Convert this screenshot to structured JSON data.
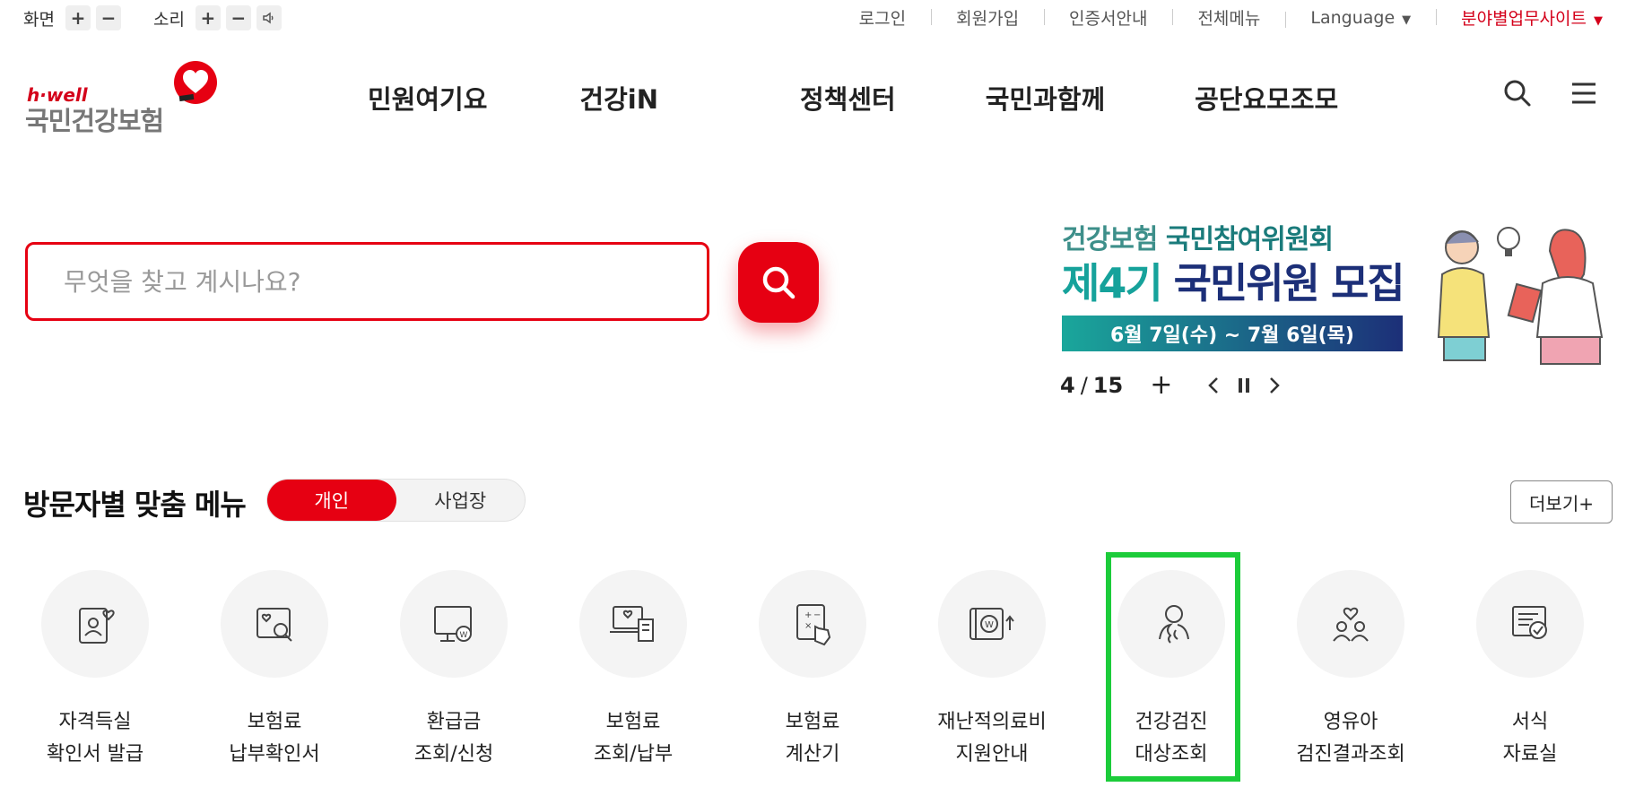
{
  "util": {
    "screen_label": "화면",
    "sound_label": "소리",
    "plus": "+",
    "minus": "−",
    "links": {
      "login": "로그인",
      "signup": "회원가입",
      "cert": "인증서안내",
      "sitemap": "전체메뉴",
      "language": "Language",
      "field_site": "분야별업무사이트"
    }
  },
  "logo": {
    "brand": "h·well",
    "name": "국민건강보험"
  },
  "gnb": [
    "민원여기요",
    "건강iN",
    "정책센터",
    "국민과함께",
    "공단요모조모"
  ],
  "search": {
    "placeholder": "무엇을 찾고 계시나요?"
  },
  "banner": {
    "line1_prefix": "건강보험 ",
    "line1_highlight": "국민참여위원회",
    "line2_prefix": "제4기 ",
    "line2_highlight": "국민위원 모집",
    "date_text": "6월 7일(수) ~ 7월 6일(목)",
    "current": "4",
    "separator": "/",
    "total": "15",
    "plus": "+"
  },
  "visitor_menu": {
    "title": "방문자별 맞춤 메뉴",
    "tab_personal": "개인",
    "tab_business": "사업장",
    "more": "더보기+",
    "items": [
      {
        "label": "자격득실\n확인서 발급",
        "icon": "id-card-heart-icon"
      },
      {
        "label": "보험료\n납부확인서",
        "icon": "document-search-icon"
      },
      {
        "label": "환급금\n조회/신청",
        "icon": "monitor-won-icon"
      },
      {
        "label": "보험료\n조회/납부",
        "icon": "laptop-receipt-icon"
      },
      {
        "label": "보험료\n계산기",
        "icon": "calculator-hand-icon"
      },
      {
        "label": "재난적의료비\n지원안내",
        "icon": "won-support-icon"
      },
      {
        "label": "건강검진\n대상조회",
        "icon": "person-checkup-icon"
      },
      {
        "label": "영유아\n검진결과조회",
        "icon": "family-heart-icon"
      },
      {
        "label": "서식\n자료실",
        "icon": "document-check-icon"
      }
    ]
  },
  "colors": {
    "accent": "#e60012",
    "highlight": "#1ccc3a",
    "teal": "#16a29b",
    "navy": "#1c2f78"
  }
}
